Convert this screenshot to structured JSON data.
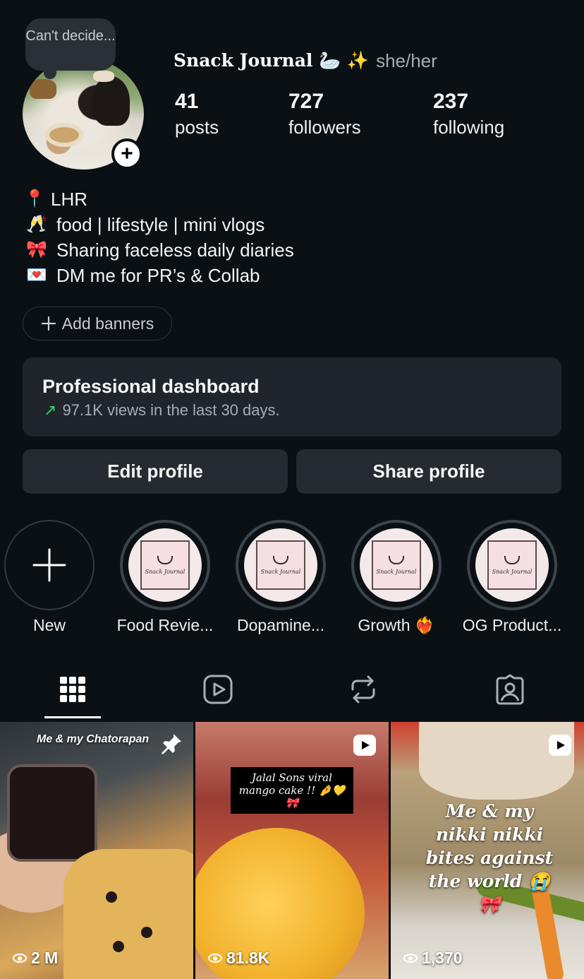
{
  "note": {
    "text": "Can't decide..."
  },
  "profile": {
    "name": "Snack Journal 🦢 ✨",
    "pronouns": "she/her",
    "stats": [
      {
        "value": "41",
        "label": "posts"
      },
      {
        "value": "727",
        "label": "followers"
      },
      {
        "value": "237",
        "label": "following"
      }
    ]
  },
  "bio": [
    {
      "icon": "📍",
      "icon_name": "pin-icon",
      "text": "LHR"
    },
    {
      "icon": "🥂",
      "icon_name": "champagne-icon",
      "text": "food | lifestyle | mini vlogs"
    },
    {
      "icon": "🎀",
      "icon_name": "ribbon-icon",
      "text": "Sharing faceless daily diaries"
    },
    {
      "icon": "💌",
      "icon_name": "love-letter-icon",
      "text": "DM me for PR’s & Collab"
    }
  ],
  "add_banners": {
    "label": "Add banners"
  },
  "dashboard": {
    "title": "Professional dashboard",
    "subtitle": "97.1K views in the last 30 days."
  },
  "buttons": {
    "edit": "Edit profile",
    "share": "Share profile"
  },
  "highlights": {
    "new_label": "New",
    "items": [
      {
        "label": "Food Revie...",
        "cover_text": "Snack Journal"
      },
      {
        "label": "Dopamine...",
        "cover_text": "Snack Journal"
      },
      {
        "label": "Growth ❤️‍🔥",
        "cover_text": "Snack Journal"
      },
      {
        "label": "OG Product...",
        "cover_text": "Snack Journal"
      }
    ]
  },
  "tabs": [
    "grid",
    "reels",
    "reposts",
    "tagged"
  ],
  "posts": [
    {
      "caption": "Me & my Chatorapan",
      "views": "2 M",
      "pinned": true
    },
    {
      "caption": "Jalal Sons viral mango cake !! 🤌💛🎀",
      "views": "81.8K",
      "reel": true
    },
    {
      "caption": "Me & my nikki nikki bites against the world 😭🎀",
      "views": "1,370",
      "reel": true
    }
  ],
  "colors": {
    "background": "#0b1014",
    "card": "#1f252b",
    "button": "#252b31",
    "trend": "#3ccf6e"
  }
}
